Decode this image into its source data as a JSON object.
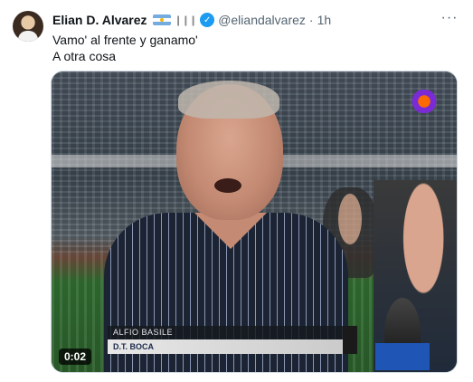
{
  "tweet": {
    "author": {
      "display_name": "Elian D. Alvarez",
      "handle": "@eliandalvarez",
      "separator": "·",
      "time": "1h",
      "verified_glyph": "✓",
      "flag_icon": "argentina-flag-icon",
      "sound_icon": "sound-wave-icon"
    },
    "text_lines": [
      "Vamo' al frente y ganamo'",
      "A otra cosa"
    ],
    "more_icon": "···",
    "media": {
      "type": "video",
      "duration": "0:02",
      "lower_third": {
        "line1": "ALFIO BASILE",
        "line2": "D.T. BOCA"
      }
    }
  },
  "colors": {
    "accent": "#1d9bf0",
    "secondary_text": "#536471",
    "border": "#cfd9de"
  }
}
